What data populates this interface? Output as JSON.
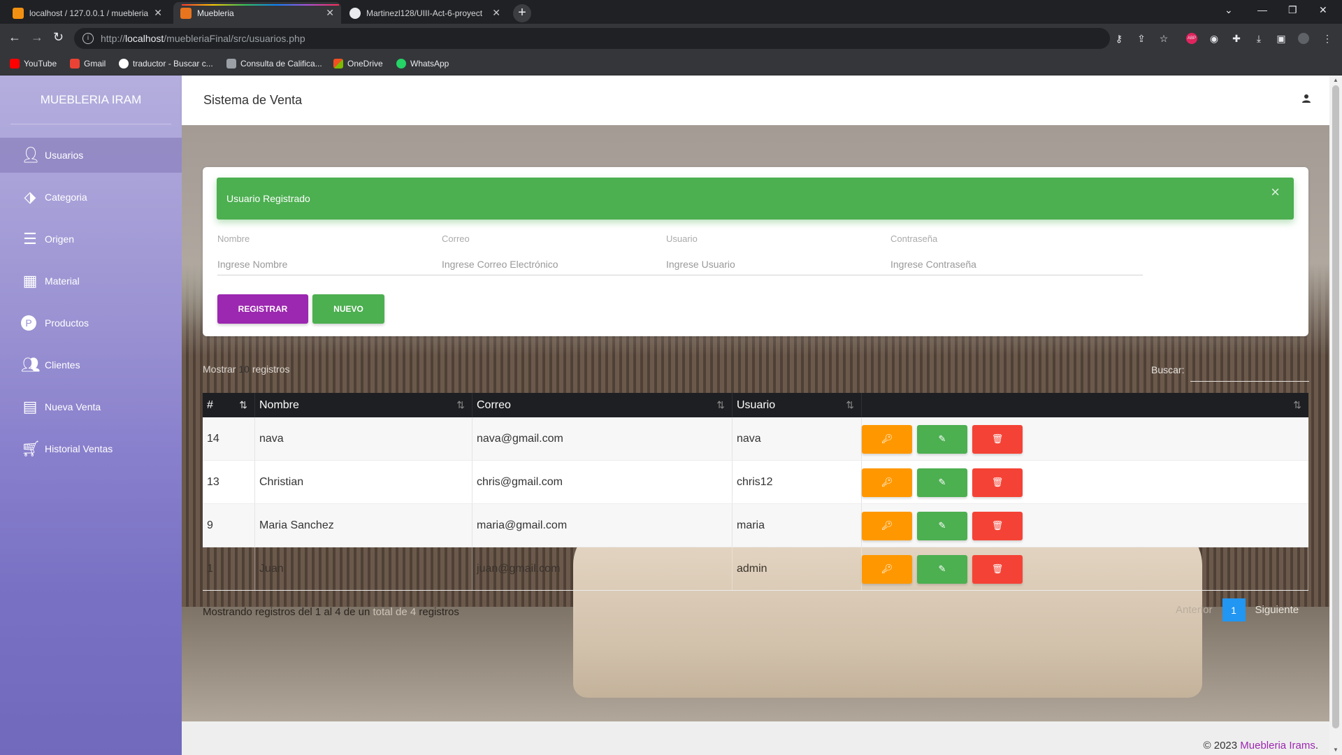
{
  "browser": {
    "tabs": [
      {
        "title": "localhost / 127.0.0.1 / muebleria"
      },
      {
        "title": "Muebleria"
      },
      {
        "title": "Martinezl128/UIII-Act-6-proyect"
      }
    ],
    "address": {
      "prefix": "http://",
      "host": "localhost",
      "path": "/muebleriaFinal/src/usuarios.php"
    },
    "bookmarks": [
      "YouTube",
      "Gmail",
      "traductor - Buscar c...",
      "Consulta de Califica...",
      "OneDrive",
      "WhatsApp"
    ]
  },
  "sidebar": {
    "brand": "MUEBLERIA IRAM",
    "items": [
      {
        "label": "Usuarios"
      },
      {
        "label": "Categoria"
      },
      {
        "label": "Origen"
      },
      {
        "label": "Material"
      },
      {
        "label": "Productos"
      },
      {
        "label": "Clientes"
      },
      {
        "label": "Nueva Venta"
      },
      {
        "label": "Historial Ventas"
      }
    ]
  },
  "navbar": {
    "title": "Sistema de Venta"
  },
  "alert": {
    "message": "Usuario Registrado",
    "close": "×"
  },
  "form": {
    "fields": [
      {
        "label": "Nombre",
        "placeholder": "Ingrese Nombre"
      },
      {
        "label": "Correo",
        "placeholder": "Ingrese Correo Electrónico"
      },
      {
        "label": "Usuario",
        "placeholder": "Ingrese Usuario"
      },
      {
        "label": "Contraseña",
        "placeholder": "Ingrese Contraseña"
      }
    ],
    "register_label": "REGISTRAR",
    "new_label": "NUEVO"
  },
  "table": {
    "length_prefix": "Mostrar",
    "length_value": "10",
    "length_suffix": "registros",
    "search_label": "Buscar:",
    "columns": [
      "#",
      "Nombre",
      "Correo",
      "Usuario",
      ""
    ],
    "rows": [
      {
        "id": "14",
        "nombre": "nava",
        "correo": "nava@gmail.com",
        "usuario": "nava"
      },
      {
        "id": "13",
        "nombre": "Christian",
        "correo": "chris@gmail.com",
        "usuario": "chris12"
      },
      {
        "id": "9",
        "nombre": "Maria Sanchez",
        "correo": "maria@gmail.com",
        "usuario": "maria"
      },
      {
        "id": "1",
        "nombre": "Juan",
        "correo": "juan@gmail.com",
        "usuario": "admin"
      }
    ],
    "info": {
      "part1": "Mostrando registros del 1 al 4 de un ",
      "part2": "total de 4",
      "part3": " registros"
    },
    "pager": {
      "prev": "Anterior",
      "page": "1",
      "next": "Siguiente"
    }
  },
  "footer": {
    "copy": "© 2023 ",
    "brand": "Muebleria Irams",
    "dot": "."
  },
  "colors": {
    "primary": "#9c27b0",
    "success": "#4caf50",
    "warning": "#ff9800",
    "danger": "#f44336",
    "info": "#2196f3"
  }
}
